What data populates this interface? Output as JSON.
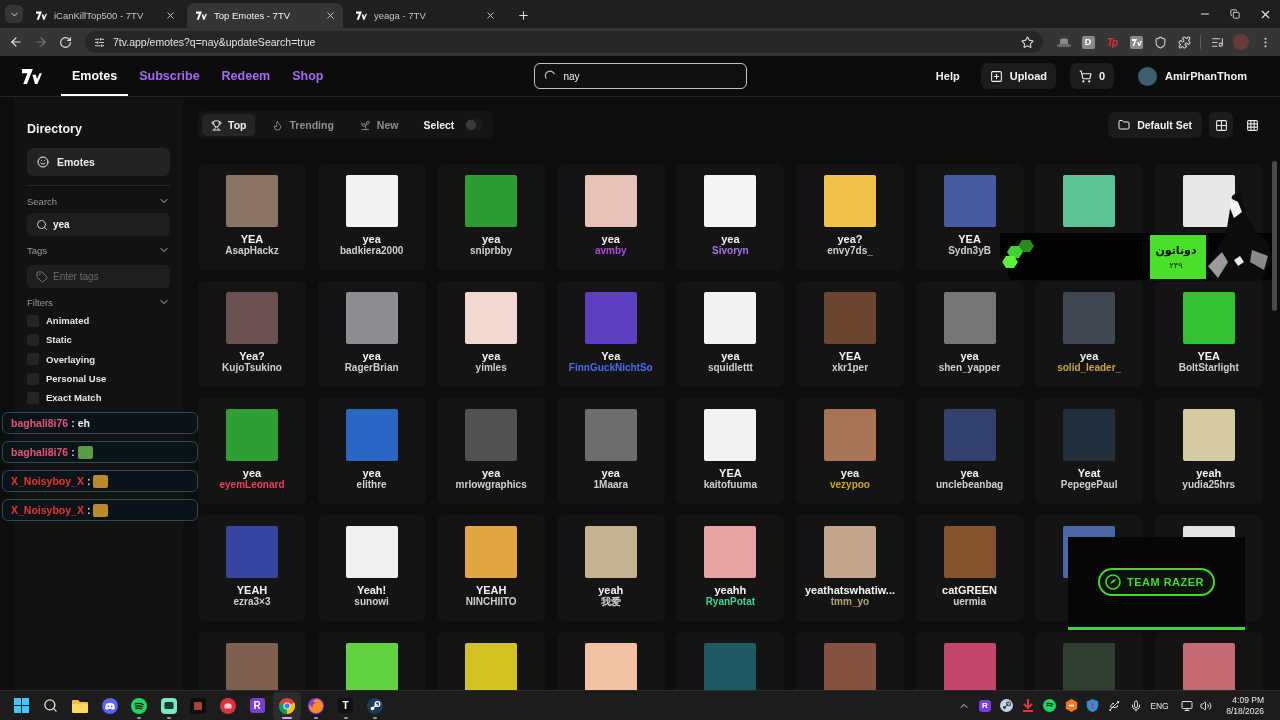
{
  "browser": {
    "tabs": [
      {
        "title": "iCanKillTop500 - 7TV",
        "selected": false
      },
      {
        "title": "Top Emotes - 7TV",
        "selected": true
      },
      {
        "title": "yeaga - 7TV",
        "selected": false
      }
    ],
    "forward": {
      "disabled": true
    },
    "url": "7tv.app/emotes?q=nay&updateSearch=true",
    "extension_labels": [
      "D",
      "Tp"
    ]
  },
  "nav": {
    "links": [
      {
        "label": "Emotes",
        "selected": true
      },
      {
        "label": "Subscribe",
        "selected": false
      },
      {
        "label": "Redeem",
        "selected": false
      },
      {
        "label": "Shop",
        "selected": false
      }
    ],
    "search": {
      "value": "nay"
    },
    "help": "Help",
    "upload": "Upload",
    "cart_count": "0",
    "user": "AmirPhanThom"
  },
  "sidebar": {
    "title": "Directory",
    "section": "Emotes",
    "search": {
      "label": "Search",
      "expanded": true,
      "value": "yea"
    },
    "tags": {
      "label": "Tags",
      "expanded": true,
      "placeholder": "Enter tags"
    },
    "filters": {
      "label": "Filters",
      "expanded": true,
      "items": [
        {
          "label": "Animated",
          "checked": false
        },
        {
          "label": "Static",
          "checked": false
        },
        {
          "label": "Overlaying",
          "checked": false
        },
        {
          "label": "Personal Use",
          "checked": false
        },
        {
          "label": "Exact Match",
          "checked": false
        }
      ]
    }
  },
  "toolbar": {
    "sort_tabs": [
      {
        "label": "Top",
        "selected": true
      },
      {
        "label": "Trending",
        "selected": false
      },
      {
        "label": "New",
        "selected": false
      }
    ],
    "select": {
      "label": "Select",
      "on": false
    },
    "emote_set": "Default Set",
    "view_modes": [
      {
        "selected": true
      },
      {
        "selected": false
      }
    ]
  },
  "emotes": [
    {
      "kind": "named",
      "name": "YEA",
      "author": "AsapHackz"
    },
    {
      "kind": "named",
      "name": "yea",
      "author": "badkiera2000"
    },
    {
      "kind": "named",
      "name": "yea",
      "author": "sniprbby"
    },
    {
      "kind": "named",
      "name": "yea",
      "author": "avmby",
      "color": "#b04ad8"
    },
    {
      "kind": "named",
      "name": "yea",
      "author": "Sivoryn",
      "color": "#a874e8"
    },
    {
      "kind": "named",
      "name": "yea?",
      "author": "envy7ds_"
    },
    {
      "kind": "named",
      "name": "YEA",
      "author": "Sydn3yB"
    },
    {
      "kind": "image"
    },
    {
      "kind": "image"
    },
    {
      "kind": "named",
      "name": "Yea?",
      "author": "KujoTsukino"
    },
    {
      "kind": "named",
      "name": "yea",
      "author": "RagerBrian"
    },
    {
      "kind": "named",
      "name": "yea",
      "author": "yimles"
    },
    {
      "kind": "named",
      "name": "Yea",
      "author": "FinnGuckNichtSo",
      "color": "#4a6cf0"
    },
    {
      "kind": "named",
      "name": "yea",
      "author": "squidlettt"
    },
    {
      "kind": "named",
      "name": "YEA",
      "author": "xkr1per"
    },
    {
      "kind": "named",
      "name": "yea",
      "author": "shen_yapper"
    },
    {
      "kind": "named",
      "name": "yea",
      "author": "solid_leader_",
      "color": "#c9a24a"
    },
    {
      "kind": "named",
      "name": "YEA",
      "author": "BoltStarlight"
    },
    {
      "kind": "named",
      "name": "yea",
      "author": "eyemLeonard",
      "color": "#e8445a"
    },
    {
      "kind": "named",
      "name": "yea",
      "author": "elithre"
    },
    {
      "kind": "named",
      "name": "yea",
      "author": "mrlowgraphics"
    },
    {
      "kind": "named",
      "name": "yea",
      "author": "1Maara"
    },
    {
      "kind": "named",
      "name": "YEA",
      "author": "kaitofuuma"
    },
    {
      "kind": "named",
      "name": "yea",
      "author": "vezypoo",
      "color": "#d4a233"
    },
    {
      "kind": "named",
      "name": "yea",
      "author": "unclebeanbag"
    },
    {
      "kind": "named",
      "name": "Yeat",
      "author": "PepegePaul"
    },
    {
      "kind": "named",
      "name": "yeah",
      "author": "yudia25hrs"
    },
    {
      "kind": "named",
      "name": "YEAH",
      "author": "ezra3×3"
    },
    {
      "kind": "named",
      "name": "Yeah!",
      "author": "sunowi"
    },
    {
      "kind": "named",
      "name": "YEAH",
      "author": "NINCHIITO"
    },
    {
      "kind": "named",
      "name": "yeah",
      "author": "我爱"
    },
    {
      "kind": "named",
      "name": "yeahh",
      "author": "RyanPotat",
      "color": "#3fd49a"
    },
    {
      "kind": "named",
      "name": "yeathatswhatiw...",
      "author": "tmm_yo",
      "color": "#b3a377"
    },
    {
      "kind": "named",
      "name": "catGREEN",
      "author": "uermia"
    },
    {
      "kind": "image"
    },
    {
      "kind": "image"
    },
    {
      "kind": "image"
    },
    {
      "kind": "image"
    },
    {
      "kind": "image"
    },
    {
      "kind": "image"
    },
    {
      "kind": "image"
    },
    {
      "kind": "image"
    },
    {
      "kind": "image"
    },
    {
      "kind": "image"
    },
    {
      "kind": "image"
    }
  ],
  "chat_overlay": [
    {
      "user": "baghali8i76",
      "color": "#e0557e",
      "separator": ":",
      "message": "eh"
    },
    {
      "user": "baghali8i76",
      "color": "#e0557e",
      "separator": ":"
    },
    {
      "user": "X_Noisyboy_X",
      "color": "#e8352e",
      "separator": ":"
    },
    {
      "user": "X_Noisyboy_X",
      "color": "#e8352e",
      "separator": ":"
    }
  ],
  "donation_overlay": {
    "title": "دوناتون",
    "subtitle": "۲۳۹"
  },
  "sponsor_overlay": {
    "text": "TEAM RAZER"
  },
  "taskbar": {
    "apps": [
      {
        "running": false,
        "active": false
      },
      {
        "running": false,
        "active": false
      },
      {
        "running": true,
        "active": false
      },
      {
        "running": true,
        "active": false
      },
      {
        "running": false,
        "active": false
      },
      {
        "running": false,
        "active": false
      },
      {
        "label": "R",
        "running": false,
        "active": false
      },
      {
        "running": true,
        "active": true
      },
      {
        "running": true,
        "active": false
      },
      {
        "label": "T",
        "running": true,
        "active": false
      },
      {
        "running": true,
        "active": false
      }
    ],
    "tray": {
      "app_label": "R",
      "language": "ENG",
      "time": "4:09 PM",
      "date": "8/18/2026"
    }
  }
}
